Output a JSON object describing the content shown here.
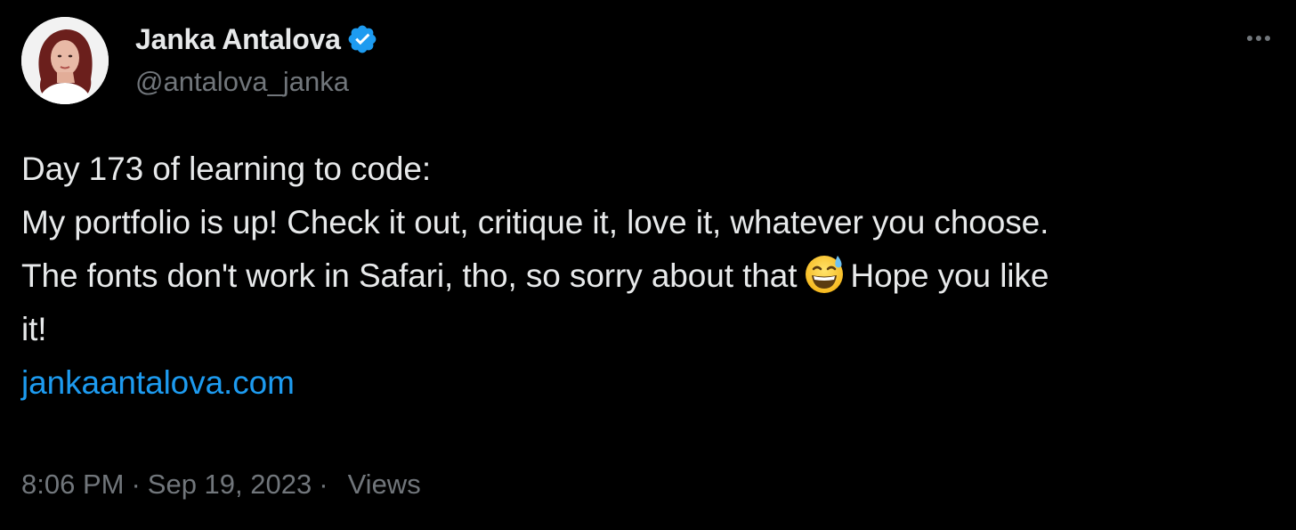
{
  "author": {
    "display_name": "Janka Antalova",
    "handle": "@antalova_janka",
    "verified_icon": "verified-badge-icon",
    "avatar_icon": "avatar-photo"
  },
  "more_icon": "more-options-icon",
  "tweet": {
    "line1": "Day 173 of learning to code:",
    "line2": "My portfolio is up! Check it out, critique it, love it, whatever you choose.",
    "line3_before_emoji": "The fonts don't work in Safari, tho, so sorry about that",
    "emoji": "grinning-face-with-sweat-icon",
    "line3_after_emoji": "Hope you like",
    "line4": "it!",
    "link": "jankaantalova.com"
  },
  "meta": {
    "time": "8:06 PM",
    "separator": "·",
    "date": "Sep 19, 2023",
    "views_label": "Views"
  },
  "colors": {
    "background": "#000000",
    "text": "#e7e9ea",
    "secondary": "#71767b",
    "link": "#1d9bf0",
    "verified": "#1d9bf0"
  }
}
